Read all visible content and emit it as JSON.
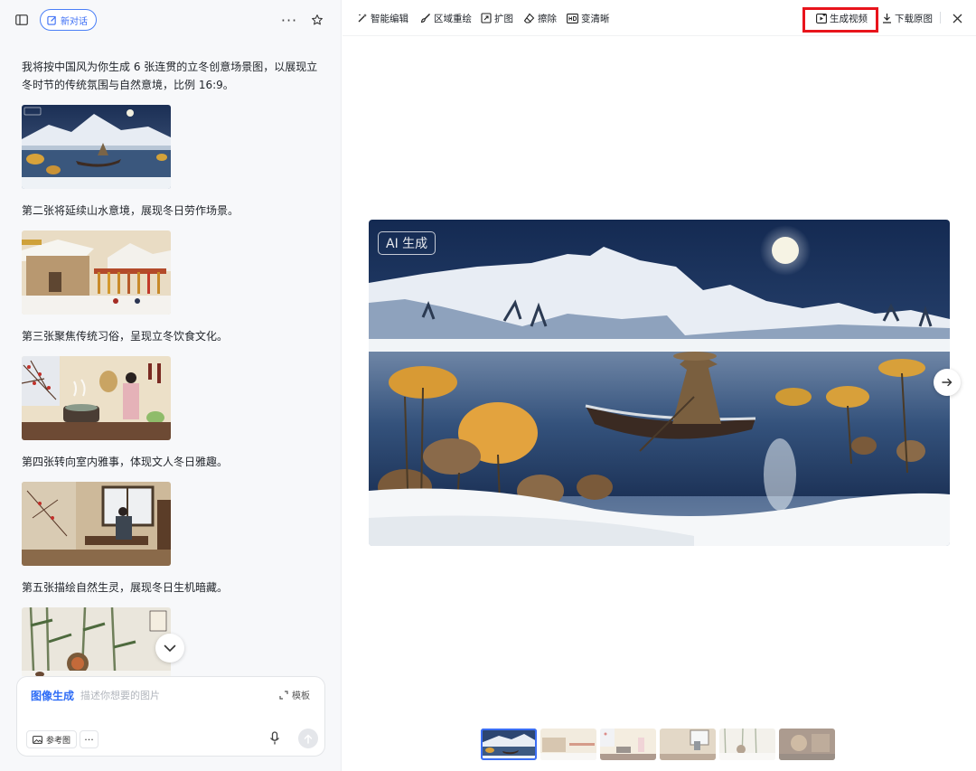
{
  "left_panel": {
    "new_chat_label": "新对话",
    "messages": [
      {
        "type": "text",
        "text": "我将按中国风为你生成 6 张连贯的立冬创意场景图，以展现立冬时节的传统氛围与自然意境，比例 16:9。"
      },
      {
        "type": "image",
        "scene": "fisherman-lake"
      },
      {
        "type": "text",
        "text": "第二张将延续山水意境，展现冬日劳作场景。"
      },
      {
        "type": "image",
        "scene": "village-harvest"
      },
      {
        "type": "text",
        "text": "第三张聚焦传统习俗，呈现立冬饮食文化。"
      },
      {
        "type": "image",
        "scene": "kitchen-custom"
      },
      {
        "type": "text",
        "text": "第四张转向室内雅事，体现文人冬日雅趣。"
      },
      {
        "type": "image",
        "scene": "scholar-room"
      },
      {
        "type": "text",
        "text": "第五张描绘自然生灵，展现冬日生机暗藏。"
      },
      {
        "type": "image",
        "scene": "bamboo-snow"
      }
    ],
    "composer": {
      "mode_label": "图像生成",
      "placeholder": "描述你想要的图片",
      "template_label": "模板",
      "reference_label": "参考图"
    }
  },
  "toolbar": {
    "tools": [
      {
        "id": "smart-edit",
        "label": "智能编辑",
        "icon": "magic-wand-icon"
      },
      {
        "id": "region-redraw",
        "label": "区域重绘",
        "icon": "brush-icon"
      },
      {
        "id": "expand",
        "label": "扩图",
        "icon": "expand-icon"
      },
      {
        "id": "erase",
        "label": "擦除",
        "icon": "eraser-icon"
      },
      {
        "id": "upscale",
        "label": "变清晰",
        "icon": "hd-icon"
      }
    ],
    "generate_video_label": "生成视频",
    "download_label": "下载原图"
  },
  "viewer": {
    "badge": "AI 生成",
    "filmstrip_count": 6,
    "active_index": 0
  },
  "colors": {
    "accent": "#3b6ef5",
    "highlight_frame": "#e8141c",
    "panel_bg": "#f7f8fa"
  }
}
